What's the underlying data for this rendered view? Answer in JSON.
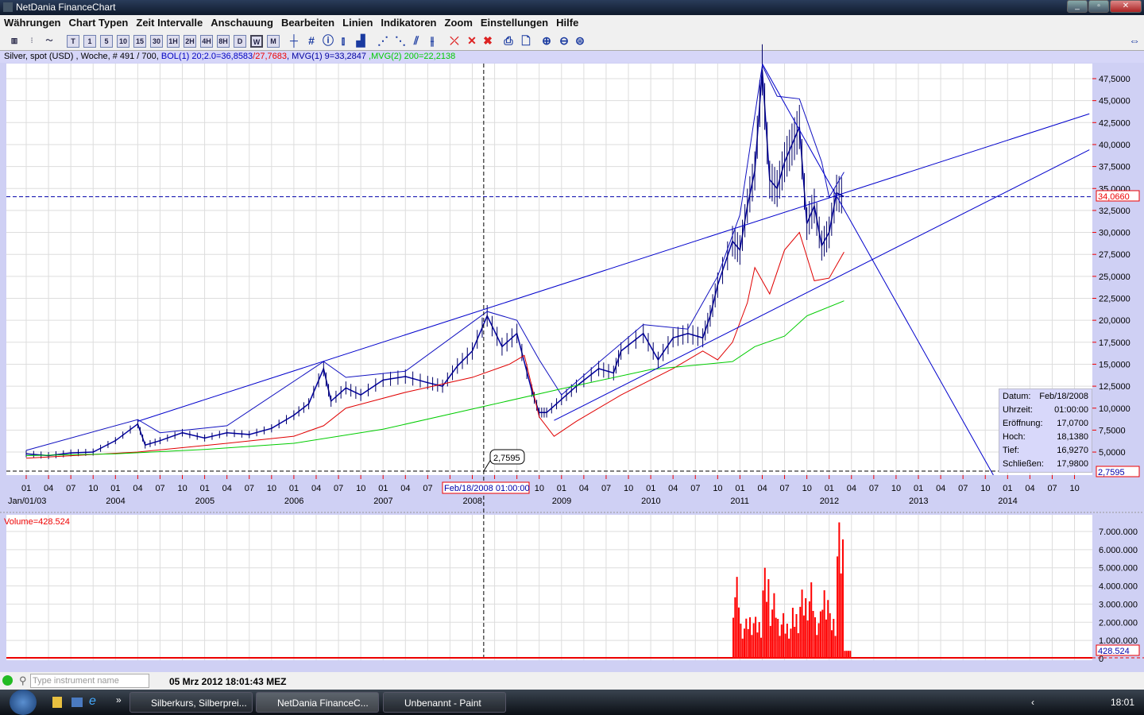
{
  "window": {
    "title": "NetDania FinanceChart"
  },
  "menu": [
    "Währungen",
    "Chart Typen",
    "Zeit Intervalle",
    "Anschauung",
    "Bearbeiten",
    "Linien",
    "Indikatoren",
    "Zoom",
    "Einstellungen",
    "Hilfe"
  ],
  "toolbar": {
    "intervals": [
      "T",
      "1",
      "5",
      "10",
      "15",
      "30",
      "1H",
      "2H",
      "4H",
      "8H",
      "D",
      "W",
      "M"
    ],
    "selected_interval": "W"
  },
  "legend": {
    "instrument": "Silver, spot (USD) , Woche, # 491 / 700, ",
    "bol_upper": "BOL(1) 20;2.0=36,8583",
    "bol_lower": "/27,7683",
    "mvg1": ", MVG(1) 9=33,2847 ",
    "mvg2": ",MVG(2) 200=22,2138"
  },
  "colors": {
    "price": "#0000a0",
    "upper_band": "#0000c0",
    "lower_band": "#e00000",
    "ma200": "#00cc00",
    "volume": "#ff0000",
    "trendline": "#0000cc"
  },
  "chart_data": [
    {
      "type": "line",
      "ylim": [
        2.5,
        49
      ],
      "xlim": [
        "2003-01",
        "2014-12"
      ],
      "y_ticks": [
        "47,5000",
        "45,0000",
        "42,5000",
        "40,0000",
        "37,5000",
        "35,0000",
        "32,5000",
        "30,0000",
        "27,5000",
        "25,0000",
        "22,5000",
        "20,0000",
        "17,5000",
        "15,0000",
        "12,5000",
        "10,0000",
        "7,5000",
        "5,0000"
      ],
      "x_ticks": {
        "months": [
          "01",
          "04",
          "07",
          "10"
        ],
        "years": [
          "2004",
          "2005",
          "2006",
          "2007",
          "2008",
          "2009",
          "2010",
          "2011",
          "2012",
          "2013",
          "2014"
        ],
        "start_label": "Jan/01/03"
      },
      "last_value_label": "34,0660",
      "crosshair_value_label": "2,7595",
      "crosshair_date_label": "Feb/18/2008 01:00:00",
      "crosshair_callout": "2,7595",
      "series": [
        {
          "key": "price",
          "points": [
            [
              "2003-01",
              4.8
            ],
            [
              "2003-04",
              4.6
            ],
            [
              "2003-07",
              4.9
            ],
            [
              "2003-10",
              5.0
            ],
            [
              "2004-01",
              6.3
            ],
            [
              "2004-04",
              8.2
            ],
            [
              "2004-05",
              5.8
            ],
            [
              "2004-07",
              6.3
            ],
            [
              "2004-10",
              7.2
            ],
            [
              "2005-01",
              6.6
            ],
            [
              "2005-04",
              7.2
            ],
            [
              "2005-07",
              7.0
            ],
            [
              "2005-10",
              7.7
            ],
            [
              "2006-01",
              9.2
            ],
            [
              "2006-03",
              10.5
            ],
            [
              "2006-05",
              14.5
            ],
            [
              "2006-06",
              10.8
            ],
            [
              "2006-08",
              12.3
            ],
            [
              "2006-10",
              11.5
            ],
            [
              "2007-01",
              13.2
            ],
            [
              "2007-04",
              13.6
            ],
            [
              "2007-07",
              12.9
            ],
            [
              "2007-09",
              12.5
            ],
            [
              "2007-11",
              14.8
            ],
            [
              "2008-01",
              16.5
            ],
            [
              "2008-03",
              20.5
            ],
            [
              "2008-05",
              17.0
            ],
            [
              "2008-07",
              18.5
            ],
            [
              "2008-09",
              12.0
            ],
            [
              "2008-10",
              9.5
            ],
            [
              "2008-11",
              9.5
            ],
            [
              "2009-01",
              11.0
            ],
            [
              "2009-03",
              12.5
            ],
            [
              "2009-06",
              14.5
            ],
            [
              "2009-08",
              14.0
            ],
            [
              "2009-09",
              16.5
            ],
            [
              "2009-12",
              18.5
            ],
            [
              "2010-02",
              15.5
            ],
            [
              "2010-04",
              18.0
            ],
            [
              "2010-06",
              18.5
            ],
            [
              "2010-08",
              18.0
            ],
            [
              "2010-09",
              20.5
            ],
            [
              "2010-10",
              24.0
            ],
            [
              "2010-12",
              29.0
            ],
            [
              "2011-01",
              28.0
            ],
            [
              "2011-02",
              33.0
            ],
            [
              "2011-03",
              37.0
            ],
            [
              "2011-04",
              48.5
            ],
            [
              "2011-05",
              36.0
            ],
            [
              "2011-06",
              35.0
            ],
            [
              "2011-07",
              38.0
            ],
            [
              "2011-08",
              40.0
            ],
            [
              "2011-09",
              42.0
            ],
            [
              "2011-10",
              31.0
            ],
            [
              "2011-11",
              33.0
            ],
            [
              "2011-12",
              28.5
            ],
            [
              "2012-01",
              30.0
            ],
            [
              "2012-02",
              34.5
            ],
            [
              "2012-03",
              34.07
            ]
          ]
        },
        {
          "key": "upper_band",
          "points": [
            [
              "2003-01",
              5.2
            ],
            [
              "2004-04",
              8.7
            ],
            [
              "2004-07",
              7.2
            ],
            [
              "2005-04",
              8.0
            ],
            [
              "2006-05",
              15.3
            ],
            [
              "2006-08",
              13.5
            ],
            [
              "2007-04",
              14.2
            ],
            [
              "2008-03",
              21.0
            ],
            [
              "2008-07",
              20.0
            ],
            [
              "2008-10",
              15.5
            ],
            [
              "2009-01",
              11.5
            ],
            [
              "2009-06",
              15.2
            ],
            [
              "2009-12",
              19.5
            ],
            [
              "2010-06",
              19.0
            ],
            [
              "2010-10",
              25.0
            ],
            [
              "2011-01",
              32.0
            ],
            [
              "2011-04",
              49.0
            ],
            [
              "2011-06",
              45.5
            ],
            [
              "2011-09",
              45.2
            ],
            [
              "2011-12",
              38.0
            ],
            [
              "2012-01",
              34.0
            ],
            [
              "2012-03",
              36.86
            ]
          ]
        },
        {
          "key": "lower_band",
          "points": [
            [
              "2003-01",
              4.3
            ],
            [
              "2004-04",
              5.0
            ],
            [
              "2005-04",
              6.0
            ],
            [
              "2006-01",
              6.8
            ],
            [
              "2006-05",
              8.0
            ],
            [
              "2006-08",
              10.0
            ],
            [
              "2007-04",
              11.8
            ],
            [
              "2008-01",
              13.5
            ],
            [
              "2008-06",
              15.0
            ],
            [
              "2008-08",
              16.0
            ],
            [
              "2008-10",
              9.0
            ],
            [
              "2008-12",
              6.8
            ],
            [
              "2009-03",
              8.5
            ],
            [
              "2009-09",
              11.5
            ],
            [
              "2010-04",
              14.5
            ],
            [
              "2010-08",
              16.5
            ],
            [
              "2010-10",
              15.5
            ],
            [
              "2010-12",
              17.5
            ],
            [
              "2011-02",
              22.0
            ],
            [
              "2011-03",
              26.0
            ],
            [
              "2011-05",
              23.0
            ],
            [
              "2011-07",
              28.0
            ],
            [
              "2011-09",
              30.0
            ],
            [
              "2011-11",
              24.5
            ],
            [
              "2012-01",
              24.8
            ],
            [
              "2012-03",
              27.77
            ]
          ]
        },
        {
          "key": "ma200",
          "points": [
            [
              "2003-01",
              4.6
            ],
            [
              "2004-01",
              4.8
            ],
            [
              "2005-01",
              5.3
            ],
            [
              "2006-01",
              6.0
            ],
            [
              "2007-01",
              7.6
            ],
            [
              "2008-01",
              9.9
            ],
            [
              "2009-01",
              12.2
            ],
            [
              "2010-01",
              14.4
            ],
            [
              "2010-12",
              15.3
            ],
            [
              "2011-03",
              17.0
            ],
            [
              "2011-07",
              18.2
            ],
            [
              "2011-10",
              20.5
            ],
            [
              "2012-03",
              22.21
            ]
          ]
        }
      ],
      "trendlines": [
        [
          [
            "2004-04",
            8.5
          ],
          [
            "2014-12",
            43.5
          ]
        ],
        [
          [
            "2008-12",
            8.6
          ],
          [
            "2014-12",
            39.4
          ]
        ],
        [
          [
            "2011-04",
            49.2
          ],
          [
            "2013-12",
            1.0
          ]
        ]
      ],
      "horizontal_lines": [
        34.066
      ]
    },
    {
      "type": "bar",
      "title": "Volume=428.524",
      "ylim": [
        0,
        7500000
      ],
      "y_ticks": [
        "7.000.000",
        "6.000.000",
        "5.000.000",
        "4.000.000",
        "3.000.000",
        "2.000.000",
        "1.000.000",
        "0"
      ],
      "last_value_label": "428.524",
      "x": [
        "2010-12",
        "2011-01",
        "2011-02",
        "2011-03",
        "2011-04",
        "2011-05",
        "2011-06",
        "2011-07",
        "2011-08",
        "2011-09",
        "2011-10",
        "2011-11",
        "2011-12",
        "2012-01",
        "2012-02",
        "2012-03"
      ],
      "values": [
        4500000,
        2200000,
        2600000,
        2300000,
        5000000,
        3600000,
        2500000,
        2200000,
        2800000,
        3800000,
        4200000,
        2600000,
        4300000,
        2500000,
        7500000,
        428524
      ]
    }
  ],
  "infobox": {
    "rows": [
      [
        "Datum:",
        "Feb/18/2008"
      ],
      [
        "Uhrzeit:",
        "01:00:00"
      ],
      [
        "Eröffnung:",
        "17,0700"
      ],
      [
        "Hoch:",
        "18,1380"
      ],
      [
        "Tief:",
        "16,9270"
      ],
      [
        "Schließen:",
        "17,9800"
      ]
    ]
  },
  "statusbar": {
    "search_placeholder": "Type instrument name",
    "clock": "05 Mrz 2012 18:01:43 MEZ"
  },
  "taskbar": {
    "tasks": [
      "Silberkurs, Silberprei...",
      "NetDania FinanceC...",
      "Unbenannt - Paint"
    ],
    "time": "18:01"
  }
}
